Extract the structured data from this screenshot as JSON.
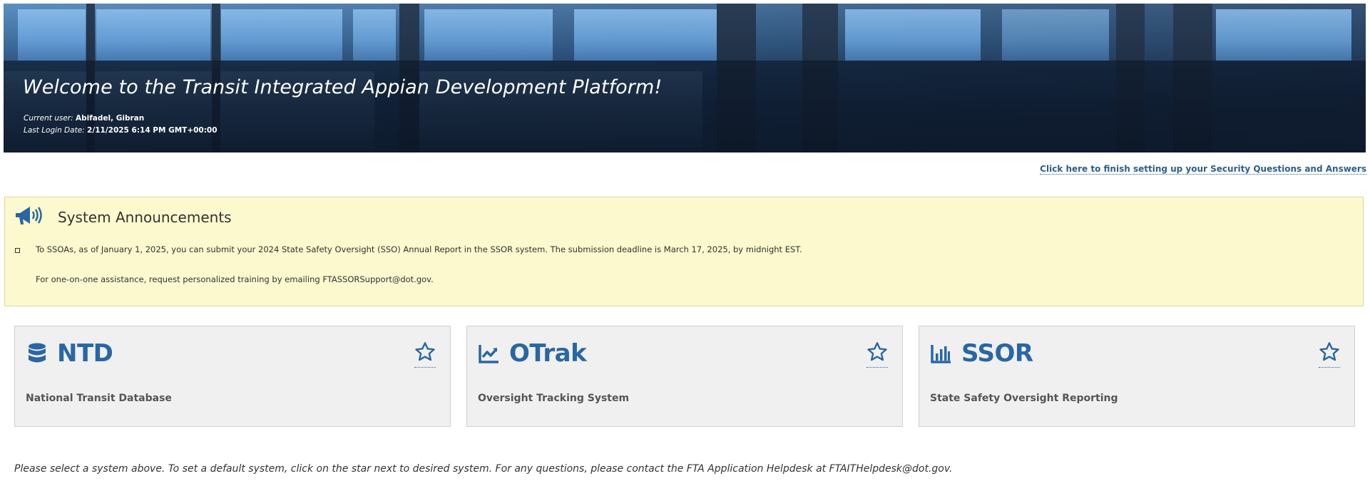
{
  "banner": {
    "title": "Welcome to the Transit Integrated Appian Development Platform!",
    "current_user_label": "Current user:",
    "current_user_value": "Abifadel, Gibran",
    "last_login_label": "Last Login Date:",
    "last_login_value": "2/11/2025 6:14 PM GMT+00:00"
  },
  "security_link": "Click here to finish setting up your Security Questions and Answers",
  "announcements": {
    "icon": "megaphone-icon",
    "title": "System Announcements",
    "items": [
      "To SSOAs, as of January 1, 2025, you can submit your 2024 State Safety Oversight (SSO) Annual Report in the SSOR system. The submission deadline is March 17, 2025, by midnight EST.",
      "For one-on-one assistance, request personalized training by emailing FTASSORSupport@dot.gov."
    ]
  },
  "systems": [
    {
      "name": "NTD",
      "description": "National Transit Database",
      "icon": "database-icon"
    },
    {
      "name": "OTrak",
      "description": "Oversight Tracking System",
      "icon": "line-chart-icon"
    },
    {
      "name": "SSOR",
      "description": "State Safety Oversight Reporting",
      "icon": "bar-chart-icon"
    }
  ],
  "help_text": "Please select a system above. To set a default system, click on the star next to desired system. For any questions, please contact the FTA Application Helpdesk at FTAITHelpdesk@dot.gov.",
  "colors": {
    "accent_blue": "#2a66a3",
    "announcement_bg": "#fbf9cd",
    "card_bg": "#f0f0f0"
  }
}
